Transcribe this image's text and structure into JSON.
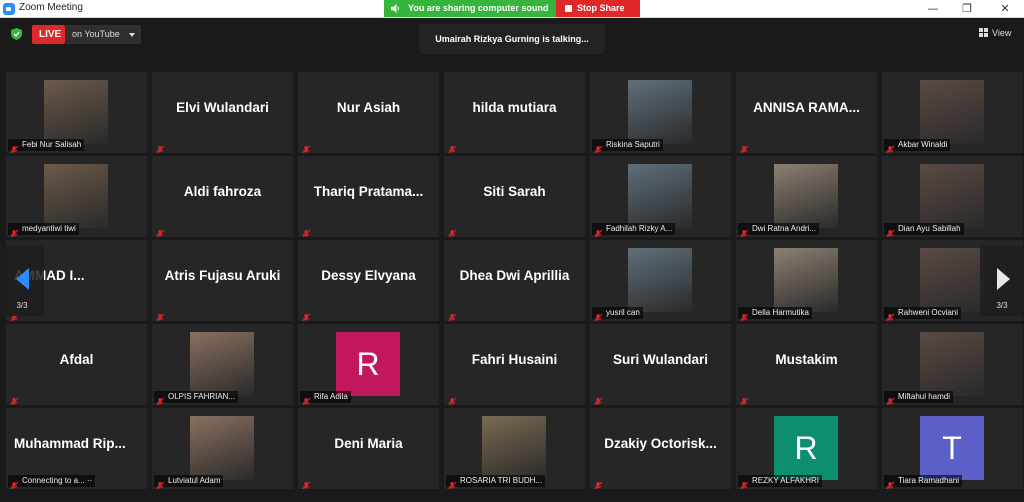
{
  "window": {
    "title": "Zoom Meeting"
  },
  "share_bar": {
    "status": "You are sharing computer sound",
    "stop_label": "Stop Share"
  },
  "live": {
    "badge": "LIVE",
    "platform": "on YouTube"
  },
  "talking": "Umairah Rizkya Gurning is talking...",
  "view_label": "View",
  "pagination": {
    "left": "3/3",
    "right": "3/3"
  },
  "colors": {
    "live_red": "#e02828",
    "share_green": "#35b53c",
    "accent_blue": "#2d8cff",
    "mute_red": "#e02828"
  },
  "participants": [
    {
      "display": "photo",
      "label": "Febi Nur Salisah"
    },
    {
      "display": "name",
      "name": "Elvi Wulandari"
    },
    {
      "display": "name",
      "name": "Nur Asiah"
    },
    {
      "display": "name",
      "name": "hilda mutiara"
    },
    {
      "display": "photo",
      "label": "Riskina Saputri"
    },
    {
      "display": "name",
      "name": "ANNISA  RAMA..."
    },
    {
      "display": "photo",
      "label": "Akbar Winaldi"
    },
    {
      "display": "photo",
      "label": "medyantiwi tiwi"
    },
    {
      "display": "name",
      "name": "Aldi fahroza"
    },
    {
      "display": "name",
      "name": "Thariq  Pratama..."
    },
    {
      "display": "name",
      "name": "Siti Sarah"
    },
    {
      "display": "photo",
      "label": "Fadhilah Rizky A..."
    },
    {
      "display": "photo",
      "label": "Dwi Ratna Andri..."
    },
    {
      "display": "photo",
      "label": "Dian Ayu Sabillah"
    },
    {
      "display": "name",
      "name": "AMMAD  I..."
    },
    {
      "display": "name",
      "name": "Atris Fujasu Aruki"
    },
    {
      "display": "name",
      "name": "Dessy Elvyana"
    },
    {
      "display": "name",
      "name": "Dhea Dwi Aprillia"
    },
    {
      "display": "photo",
      "label": "yusril can"
    },
    {
      "display": "photo",
      "label": "Della Harmutika"
    },
    {
      "display": "photo",
      "label": "Rahweni Ocviani"
    },
    {
      "display": "name",
      "name": "Afdal"
    },
    {
      "display": "photo",
      "label": "OLPIS FAHRIAN..."
    },
    {
      "display": "avatar",
      "letter": "R",
      "color": "#c2185b",
      "label": "Rifa Adila"
    },
    {
      "display": "name",
      "name": "Fahri Husaini"
    },
    {
      "display": "name",
      "name": "Suri Wulandari"
    },
    {
      "display": "name",
      "name": "Mustakim"
    },
    {
      "display": "photo",
      "label": "Miftahul hamdi"
    },
    {
      "display": "name",
      "name": "Muhammad  Rip...",
      "label": "Connecting to a... ··"
    },
    {
      "display": "photo",
      "label": "Lutviatul Adam"
    },
    {
      "display": "name",
      "name": "Deni Maria"
    },
    {
      "display": "photo",
      "label": "ROSARIA TRI BUDH..."
    },
    {
      "display": "name",
      "name": "Dzakiy  Octorisk..."
    },
    {
      "display": "avatar",
      "letter": "R",
      "color": "#0d8f6e",
      "label": "REZKY ALFAKHRI"
    },
    {
      "display": "avatar",
      "letter": "T",
      "color": "#5b5fc7",
      "label": "Tiara Ramadhani"
    }
  ]
}
